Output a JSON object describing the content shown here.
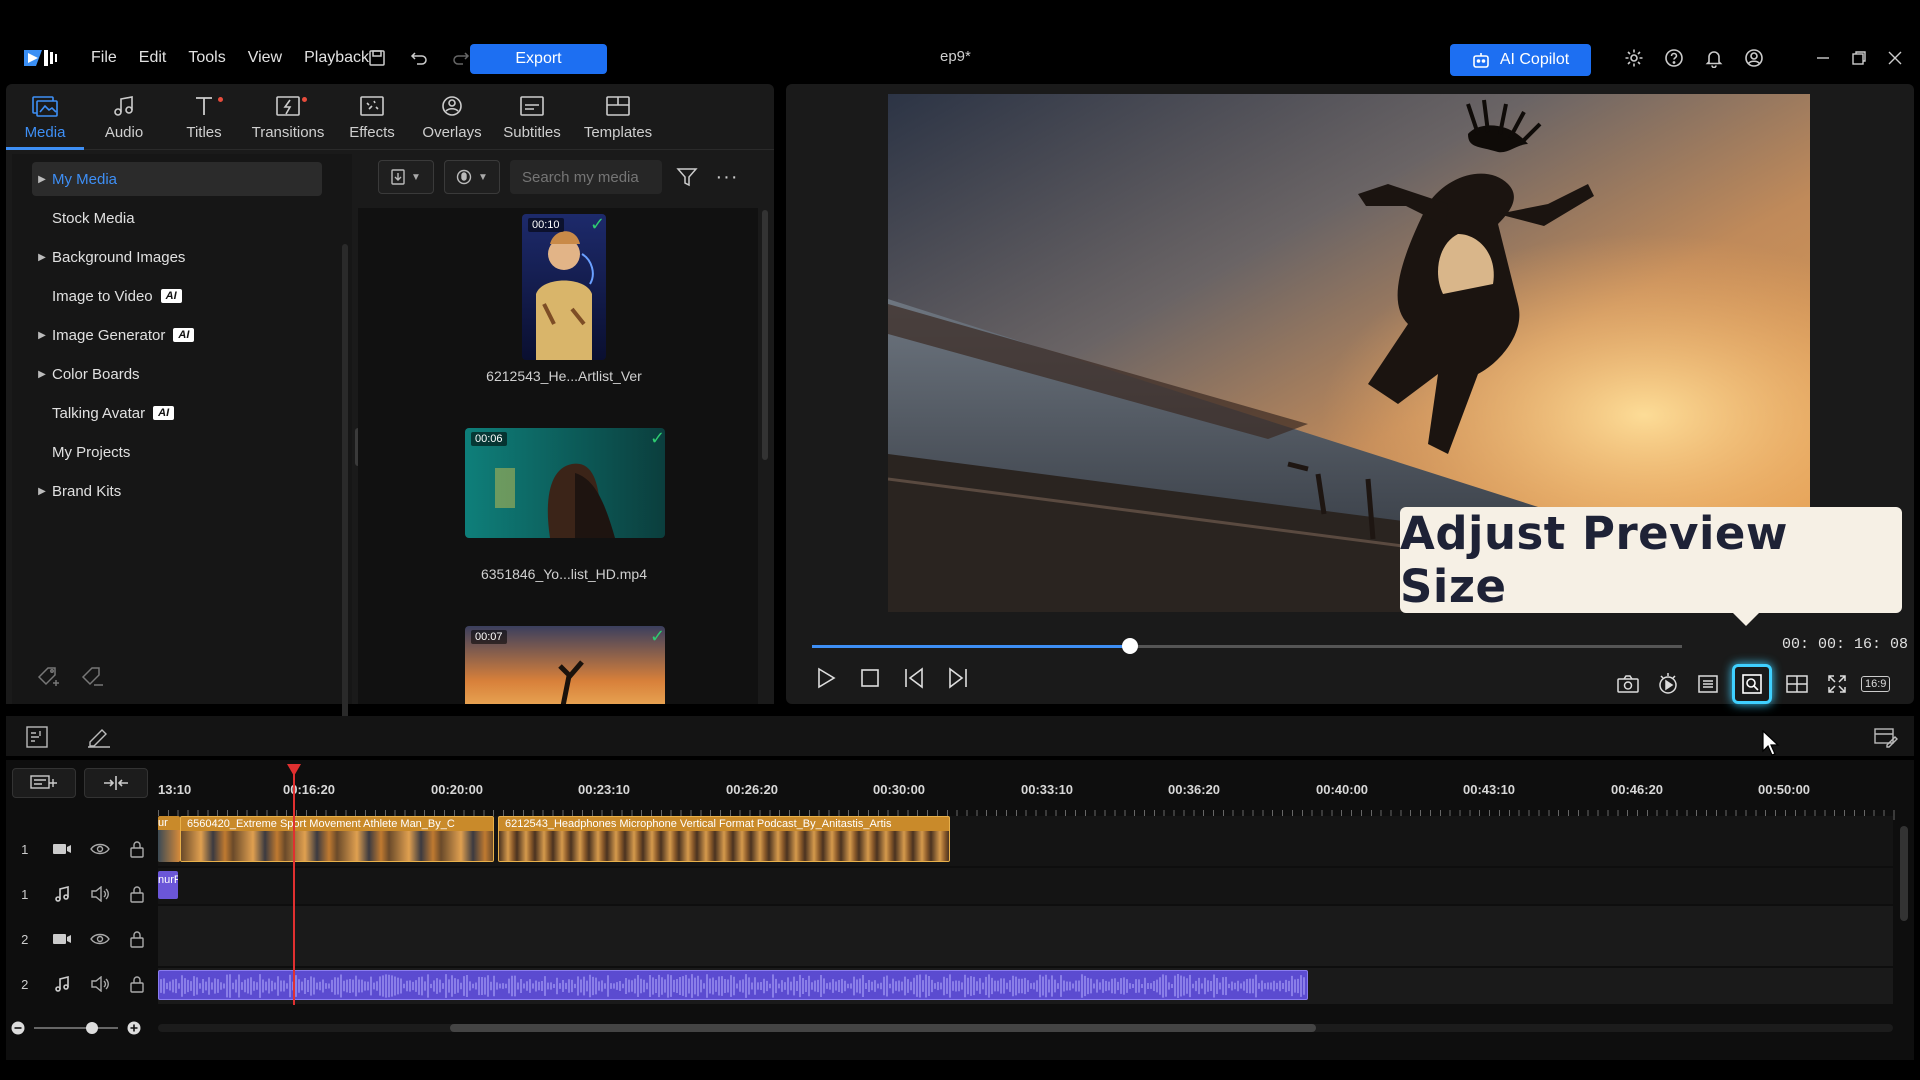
{
  "app": {
    "doc_title": "ep9*"
  },
  "menu": [
    "File",
    "Edit",
    "Tools",
    "View",
    "Playback"
  ],
  "toolbar": {
    "export_label": "Export"
  },
  "copilot": {
    "label": "AI Copilot"
  },
  "library": {
    "tabs": [
      {
        "label": "Media",
        "icon": "media-icon",
        "active": true
      },
      {
        "label": "Audio",
        "icon": "music-note-icon"
      },
      {
        "label": "Titles",
        "icon": "title-t-icon",
        "new_dot": true
      },
      {
        "label": "Transitions",
        "icon": "transition-icon",
        "new_dot": true
      },
      {
        "label": "Effects",
        "icon": "effects-icon"
      },
      {
        "label": "Overlays",
        "icon": "overlays-icon"
      },
      {
        "label": "Subtitles",
        "icon": "subtitles-icon"
      },
      {
        "label": "Templates",
        "icon": "templates-icon"
      }
    ],
    "tree": [
      {
        "label": "My Media",
        "expandable": true,
        "selected": true
      },
      {
        "label": "Stock Media",
        "expandable": false
      },
      {
        "label": "Background Images",
        "expandable": true
      },
      {
        "label": "Image to Video",
        "expandable": false,
        "ai": true
      },
      {
        "label": "Image Generator",
        "expandable": true,
        "ai": true
      },
      {
        "label": "Color Boards",
        "expandable": true
      },
      {
        "label": "Talking Avatar",
        "expandable": false,
        "ai": true
      },
      {
        "label": "My Projects",
        "expandable": false
      },
      {
        "label": "Brand Kits",
        "expandable": true
      }
    ],
    "ai_badge": "AI",
    "search_placeholder": "Search my media",
    "media": [
      {
        "duration": "00:10",
        "name": "6212543_He...Artlist_Ver",
        "checked": true
      },
      {
        "duration": "00:06",
        "name": "6351846_Yo...list_HD.mp4",
        "checked": true
      },
      {
        "duration": "00:07",
        "name": "",
        "checked": true
      }
    ]
  },
  "preview": {
    "callout": "Adjust Preview Size",
    "timecode": "00: 00: 16: 08",
    "progress": 0.365,
    "ratio_label": "16:9"
  },
  "timeline": {
    "ruler": [
      "13:10",
      "00:16:20",
      "00:20:00",
      "00:23:10",
      "00:26:20",
      "00:30:00",
      "00:33:10",
      "00:36:20",
      "00:40:00",
      "00:43:10",
      "00:46:20",
      "00:50:00"
    ],
    "tracks": [
      {
        "num": "1",
        "type": "video"
      },
      {
        "num": "1",
        "type": "audio"
      },
      {
        "num": "2",
        "type": "video"
      },
      {
        "num": "2",
        "type": "audio"
      }
    ],
    "clips": {
      "video1_a": "ur",
      "video1_b": "6560420_Extreme Sport Movement Athlete Man_By_C",
      "video1_c": "6212543_Headphones Microphone Vertical Format Podcast_By_Anitastis_Artis",
      "audio1": "nurF"
    }
  }
}
